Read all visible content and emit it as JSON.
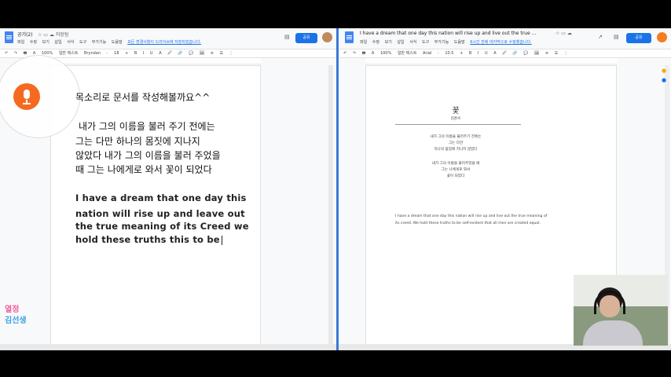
{
  "left": {
    "title": "공기(2)",
    "title_icons": "☆ ▭ ☁ 저장됨",
    "menus": [
      "파일",
      "수정",
      "보기",
      "삽입",
      "서식",
      "도구",
      "부가기능",
      "도움말"
    ],
    "edit_note": "모든 변경사항이 드라이브에 저장되었습니다.",
    "share_label": "공유",
    "toolbar": [
      "↶",
      "↷",
      "🖶",
      "A",
      "100%",
      "일반 텍스트",
      "Bryndan",
      "-",
      "18",
      "+",
      "B",
      "I",
      "U",
      "A",
      "🖉",
      "🔗",
      "💬",
      "🖼",
      "≡",
      "☰",
      "⋮"
    ],
    "body_line": "목소리로 문서를 작성해볼까요^^",
    "poem_lines": [
      "내가 그의 이름을 불러 주기 전에는",
      "그는 다만 하나의 몸짓에 지나지",
      "않았다 내가 그의 이름을 불러 주었을",
      "때 그는 나에게로 와서 꽃이 되었다"
    ],
    "english_lines": [
      "I have a dream that one day this",
      "nation will rise up and leave out",
      "the true meaning of its Creed we",
      "hold these truths this to be"
    ],
    "logo_line1": "열정",
    "logo_line2": "김선생"
  },
  "right": {
    "title": "I have a dream that one day this nation will rise up and live out the true ...",
    "title_icons": "☆ ▭ ☁",
    "menus": [
      "파일",
      "수정",
      "보기",
      "삽입",
      "서식",
      "도구",
      "부가기능",
      "도움말"
    ],
    "edit_note": "6시간 전에 마지막으로 수정했습니다.",
    "share_label": "공유",
    "toolbar": [
      "↶",
      "↷",
      "🖶",
      "A",
      "100%",
      "일반 텍스트",
      "Arial",
      "-",
      "10.5",
      "+",
      "B",
      "I",
      "U",
      "A",
      "🖉",
      "🔗",
      "💬",
      "🖼",
      "≡",
      "☰",
      "⋮"
    ],
    "poem_title": "꽃",
    "poem_author": "김춘수",
    "poem_stanza1": [
      "내가 그의 이름을 불러주기 전에는",
      "그는 다만",
      "하나의 몸짓에 지나지 않았다"
    ],
    "poem_stanza2": [
      "내가 그의 이름을 불러주었을 때",
      "그는 나에게로 와서",
      "꽃이 되었다"
    ],
    "english_lines": [
      "I have a dream that one day this nation will rise up and live out the true meaning of",
      "its creed. We hold these truths to be self-evident that all men are created equal."
    ]
  },
  "colors": {
    "accent": "#1a73e8",
    "mic": "#f56a20",
    "logo_pink": "#f0609a",
    "logo_blue": "#3fa0e8"
  }
}
